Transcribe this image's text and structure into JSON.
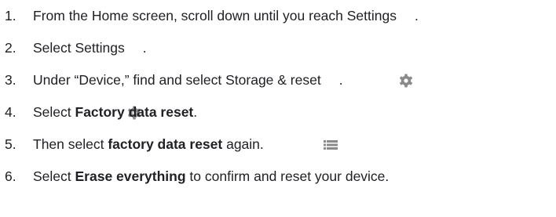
{
  "steps": [
    {
      "num": "1.",
      "pre": "From the Home screen, scroll down until you reach Settings",
      "icon": "gear-icon",
      "post": "."
    },
    {
      "num": "2.",
      "pre": "Select Settings",
      "icon": "gear-icon",
      "post": "."
    },
    {
      "num": "3.",
      "pre": "Under “Device,” find and select Storage & reset",
      "icon": "storage-icon",
      "post": "."
    },
    {
      "num": "4.",
      "pre": "Select ",
      "bold": "Factory data reset",
      "post": "."
    },
    {
      "num": "5.",
      "pre": "Then select ",
      "bold": "factory data reset",
      "post": " again."
    },
    {
      "num": "6.",
      "pre": "Select ",
      "bold": "Erase everything",
      "post": " to confirm and reset your device."
    }
  ],
  "colors": {
    "text": "#202124",
    "icon": "#8a8a8a"
  }
}
